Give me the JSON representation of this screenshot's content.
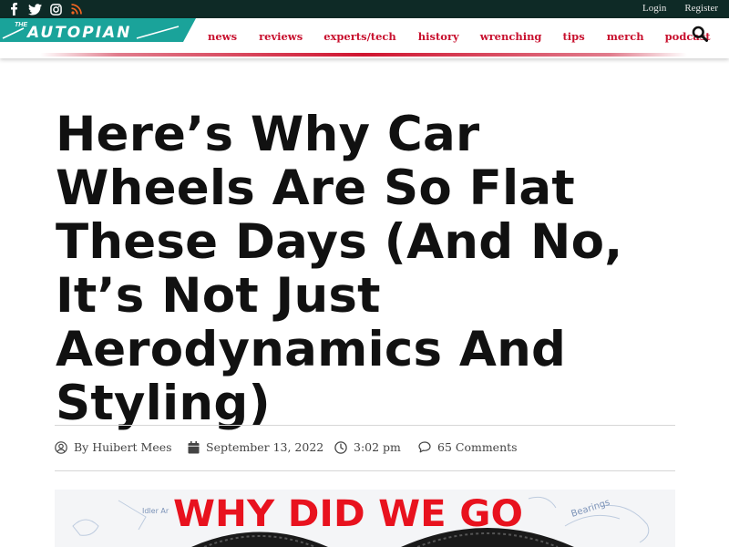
{
  "topbar": {
    "social_icons": [
      "facebook-icon",
      "twitter-icon",
      "instagram-icon",
      "rss-icon"
    ],
    "login_label": "Login",
    "register_label": "Register"
  },
  "logo": {
    "prefix": "THE",
    "name": "AUTOPIAN"
  },
  "nav": {
    "items": [
      "news",
      "reviews",
      "experts/tech",
      "history",
      "wrenching",
      "tips",
      "merch",
      "podcast"
    ]
  },
  "article": {
    "title": "Here’s Why Car Wheels Are So Flat These Days (And No, It’s Not Just Aerodynamics And Styling)",
    "author": "By Huibert Mees",
    "date": "September 13, 2022",
    "time": "3:02 pm",
    "comments": "65 Comments"
  },
  "hero": {
    "headline_text": "WHY DID WE GO",
    "small_labels": [
      "Idler Ar",
      "Bearings"
    ]
  },
  "colors": {
    "topbar_bg": "#0e2a26",
    "brand_teal": "#1aa39a",
    "nav_red": "#c8102e",
    "headline_text": "#111111"
  }
}
